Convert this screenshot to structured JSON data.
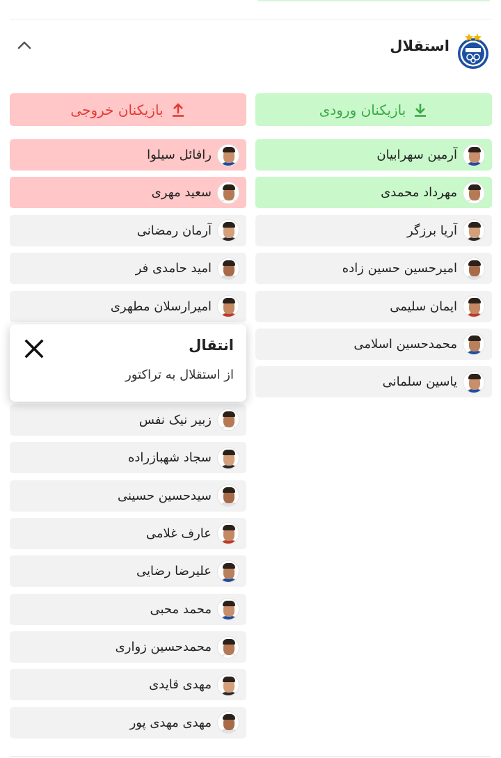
{
  "team": {
    "name": "استقلال",
    "logo_icon": "esteghlal-logo-icon",
    "collapse_icon": "chevron-up-icon"
  },
  "incoming": {
    "title": "بازیکنان ورودی",
    "icon": "download-arrow-icon",
    "color": "#3ba845",
    "players": [
      {
        "name": "آرمین سهرابیان",
        "highlight": true
      },
      {
        "name": "مهرداد محمدی",
        "highlight": true
      },
      {
        "name": "آریا برزگر",
        "highlight": false
      },
      {
        "name": "امیرحسین حسین زاده",
        "highlight": false
      },
      {
        "name": "ایمان سلیمی",
        "highlight": false
      },
      {
        "name": "محمدحسین اسلامی",
        "highlight": false
      },
      {
        "name": "یاسین سلمانی",
        "highlight": false
      }
    ]
  },
  "outgoing": {
    "title": "بازیکنان خروجی",
    "icon": "upload-arrow-icon",
    "color": "#e53935",
    "players": [
      {
        "name": "رافائل سیلوا",
        "highlight": true
      },
      {
        "name": "سعید مهری",
        "highlight": true
      },
      {
        "name": "آرمان رمضانی",
        "highlight": false
      },
      {
        "name": "امید حامدی فر",
        "highlight": false
      },
      {
        "name": "امیرارسلان مطهری",
        "highlight": false
      },
      {
        "name": "",
        "highlight": false
      },
      {
        "name": "",
        "highlight": false
      },
      {
        "name": "زبیر نیک نفس",
        "highlight": false
      },
      {
        "name": "سجاد شهبازراده",
        "highlight": false
      },
      {
        "name": "سیدحسین حسینی",
        "highlight": false
      },
      {
        "name": "عارف غلامی",
        "highlight": false
      },
      {
        "name": "علیرضا رضایی",
        "highlight": false
      },
      {
        "name": "محمد محبی",
        "highlight": false
      },
      {
        "name": "محمدحسین زواری",
        "highlight": false
      },
      {
        "name": "مهدی قایدی",
        "highlight": false
      },
      {
        "name": "مهدی مهدی پور",
        "highlight": false
      }
    ]
  },
  "popup": {
    "title": "انتقال",
    "description": "از استقلال به تراکتور",
    "close_icon": "close-icon"
  }
}
